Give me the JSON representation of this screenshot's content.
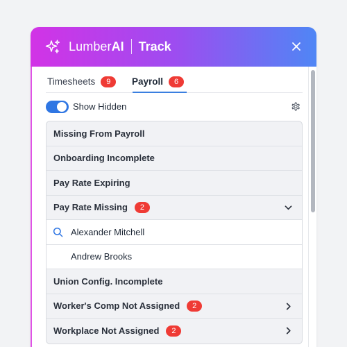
{
  "header": {
    "brand_name": "Lumber",
    "brand_ai": "AI",
    "product": "Track",
    "sparkle_icon": "sparkle-icon",
    "close_icon": "close-icon",
    "gradient": [
      "#d233e6",
      "#4f86f5"
    ]
  },
  "tabs": [
    {
      "label": "Timesheets",
      "count": "9",
      "active": false
    },
    {
      "label": "Payroll",
      "count": "6",
      "active": true
    }
  ],
  "toggle": {
    "label": "Show Hidden",
    "on": true,
    "settings_icon": "gear-icon"
  },
  "list": {
    "items": [
      {
        "label": "Missing From Payroll"
      },
      {
        "label": "Onboarding Incomplete"
      },
      {
        "label": "Pay Rate Expiring"
      },
      {
        "label": "Pay Rate Missing",
        "count": "2",
        "expanded": true,
        "children": [
          {
            "label": "Alexander Mitchell",
            "icon": "search-icon"
          },
          {
            "label": "Andrew Brooks"
          }
        ]
      },
      {
        "label": "Union Config. Incomplete"
      },
      {
        "label": "Worker's Comp Not Assigned",
        "count": "2"
      },
      {
        "label": "Workplace Not Assigned",
        "count": "2"
      }
    ]
  },
  "colors": {
    "accent": "#2f76e3",
    "badge": "#ef3b35"
  }
}
